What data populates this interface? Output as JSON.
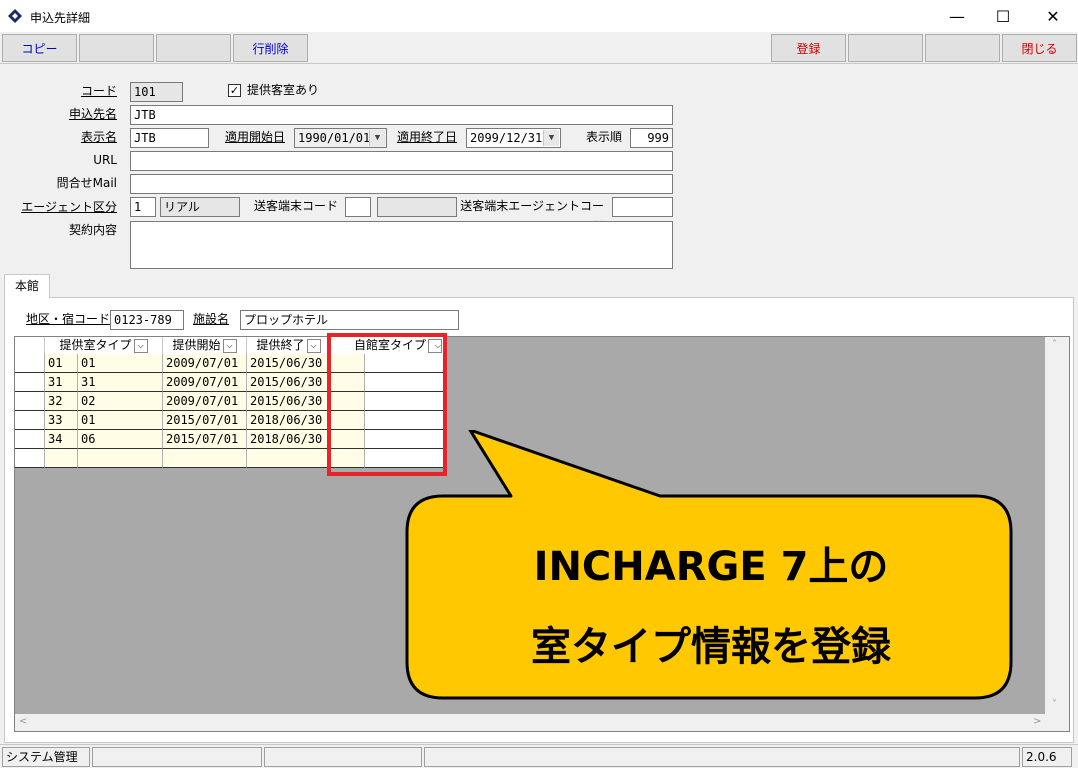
{
  "window": {
    "title": "申込先詳細",
    "minimize": "—",
    "maximize": "☐",
    "close": "✕"
  },
  "toolbar": {
    "copy": "コピー",
    "delete_row": "行削除",
    "register": "登録",
    "close": "閉じる"
  },
  "form": {
    "code_label": "コード",
    "code_value": "101",
    "checkbox_mark": "✓",
    "checkbox_label": "提供客室あり",
    "applicant_label": "申込先名",
    "applicant_value": "JTB",
    "display_name_label": "表示名",
    "display_name_value": "JTB",
    "start_label": "適用開始日",
    "start_value": "1990/01/01",
    "end_label": "適用終了日",
    "end_value": "2099/12/31",
    "order_label": "表示順",
    "order_value": "999",
    "url_label": "URL",
    "url_value": "",
    "mail_label": "問合せMail",
    "mail_value": "",
    "agent_label": "エージェント区分",
    "agent_code": "1",
    "agent_name": "リアル",
    "terminal_label": "送客端末コード",
    "terminal_value": "",
    "terminal_name": "",
    "terminal_agent_label": "送客端末エージェントコード",
    "terminal_agent_value": "",
    "contract_label": "契約内容",
    "contract_value": ""
  },
  "tab": {
    "label": "本館"
  },
  "facility": {
    "area_label": "地区・宿コード",
    "area_value": "0123-789",
    "name_label": "施設名",
    "name_value": "プロップホテル"
  },
  "grid": {
    "headers": [
      "提供室タイプ",
      "提供開始",
      "提供終了",
      "自館室タイプ"
    ],
    "dropdown_glyph": "⌵",
    "rows": [
      [
        "01",
        "01",
        "2009/07/01",
        "2015/06/30",
        ""
      ],
      [
        "31",
        "31",
        "2009/07/01",
        "2015/06/30",
        ""
      ],
      [
        "32",
        "02",
        "2009/07/01",
        "2015/06/30",
        ""
      ],
      [
        "33",
        "01",
        "2015/07/01",
        "2018/06/30",
        ""
      ],
      [
        "34",
        "06",
        "2015/07/01",
        "2018/06/30",
        ""
      ],
      [
        "",
        "",
        "",
        "",
        ""
      ]
    ]
  },
  "scroll": {
    "up": "˄",
    "down": "˅",
    "left": "<",
    "right": ">"
  },
  "callout": {
    "line1": "INCHARGE 7上の",
    "line2": "室タイプ情報を登録",
    "fill": "#ffc800"
  },
  "status": {
    "user": "システム管理者",
    "version": "2.0.6"
  }
}
